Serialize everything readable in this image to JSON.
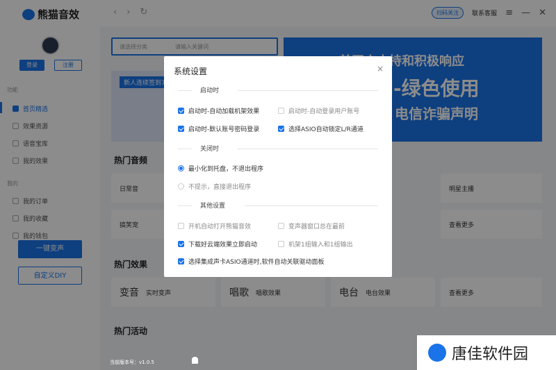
{
  "app": {
    "title": "熊猫音效",
    "version": "当前版本号：v1.0.5"
  },
  "top": {
    "scan": "扫码关注",
    "service": "联系客服",
    "menu": "≡",
    "minimize": "—",
    "close": "✕",
    "back": "‹",
    "forward": "›",
    "refresh": "↻"
  },
  "sidebar": {
    "login": "登录",
    "register": "注册",
    "section_func": "功能",
    "section_mine": "我的",
    "items": [
      "首页精选",
      "效果资源",
      "语音宝库",
      "我的效果",
      "我的订单",
      "我的收藏",
      "我的钱包"
    ],
    "btn_change": "一键变声",
    "btn_diy": "自定义DIY"
  },
  "main": {
    "search_category": "请选择分类",
    "search_placeholder": "请输入关键词",
    "banner_l1": "首开启支持和积极响应",
    "banner_l2": "网-绿色使用",
    "banner_l3": "电信诈骗声明",
    "promo": "新人连续签到7",
    "hot_audio": "热门音频",
    "hot_effect": "热门效果",
    "hot_activity": "热门活动",
    "cards_audio": [
      "日常音",
      "明星主播",
      "搞笑宠",
      "查看更多"
    ],
    "cards_effect": [
      {
        "big": "变音",
        "small": "实时变声"
      },
      {
        "big": "唱歌",
        "small": "唱歌效果"
      },
      {
        "big": "电台",
        "small": "电台效果"
      },
      {
        "big": "",
        "small": "查看更多"
      }
    ]
  },
  "modal": {
    "title": "系统设置",
    "close": "×",
    "group_startup": "启动时",
    "opt_auto_load": "启动时-自动加载机架效果",
    "opt_auto_login": "启动时-自动登录用户账号",
    "opt_default_pwd": "启动时-默认账号密码登录",
    "opt_asio_lock": "选择ASIO自动锁定L/R通道",
    "group_close": "关闭时",
    "opt_minimize": "最小化到托盘，不退出程序",
    "opt_exit": "不提示，直接退出程序",
    "group_other": "其他设置",
    "opt_open_on_boot": "开机自动打开熊猫音效",
    "opt_topmost": "变声器窗口总在最前",
    "opt_download": "下载好云端效果立即启动",
    "opt_rack": "机架1组输入和1组输出",
    "opt_asio_panel": "选择集成声卡ASIO通道时,软件自动关联驱动面板"
  },
  "watermark": {
    "text": "唐佳软件园"
  }
}
